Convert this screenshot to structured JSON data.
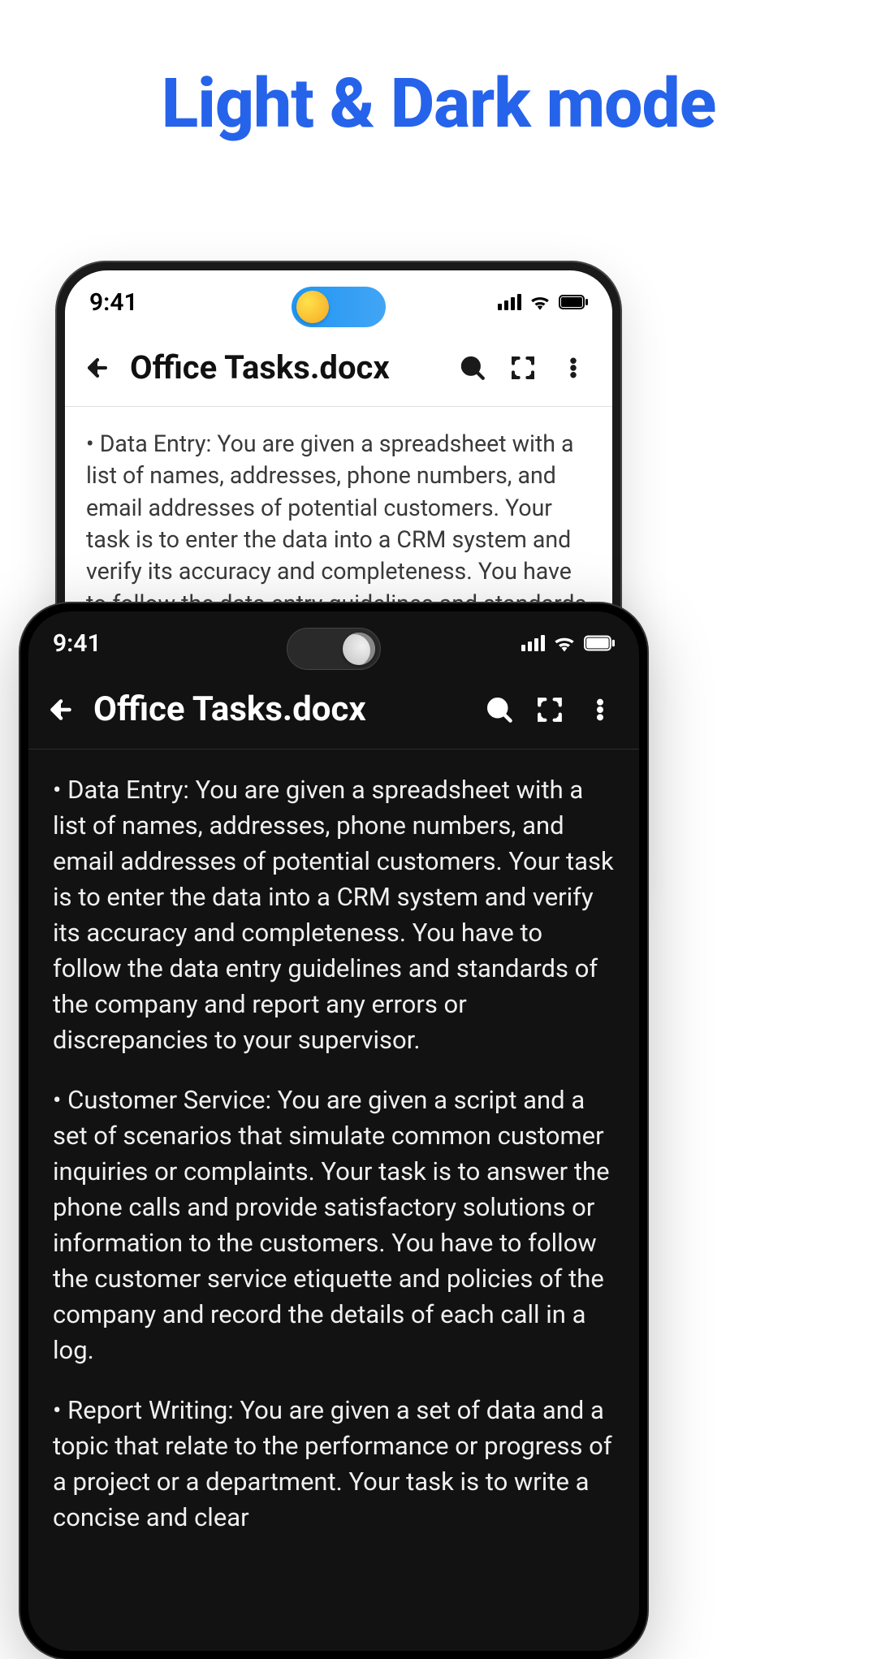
{
  "headline": "Light & Dark mode",
  "status": {
    "time": "9:41"
  },
  "toolbar": {
    "title": "Office Tasks.docx"
  },
  "doc": {
    "para1": "Data Entry: You are given a spreadsheet with a list of names, addresses, phone numbers, and email addresses of potential customers. Your task is to enter the data into a CRM system and verify its accuracy and completeness. You have to follow the data entry guidelines and standards of the company and report any errors or discrepancies to your supervisor.",
    "para2": "Customer Service: You are given a script and a set of scenarios that simulate common customer inquiries or complaints. Your task is to answer the phone calls and provide satisfactory solutions or information to the customers. You have to follow the customer service etiquette and policies of the company and record the details of each call in a log.",
    "para3": "Report Writing: You are given a set of data and a topic that relate to the performance or progress of a project or a department. Your task is to write a concise and clear"
  }
}
